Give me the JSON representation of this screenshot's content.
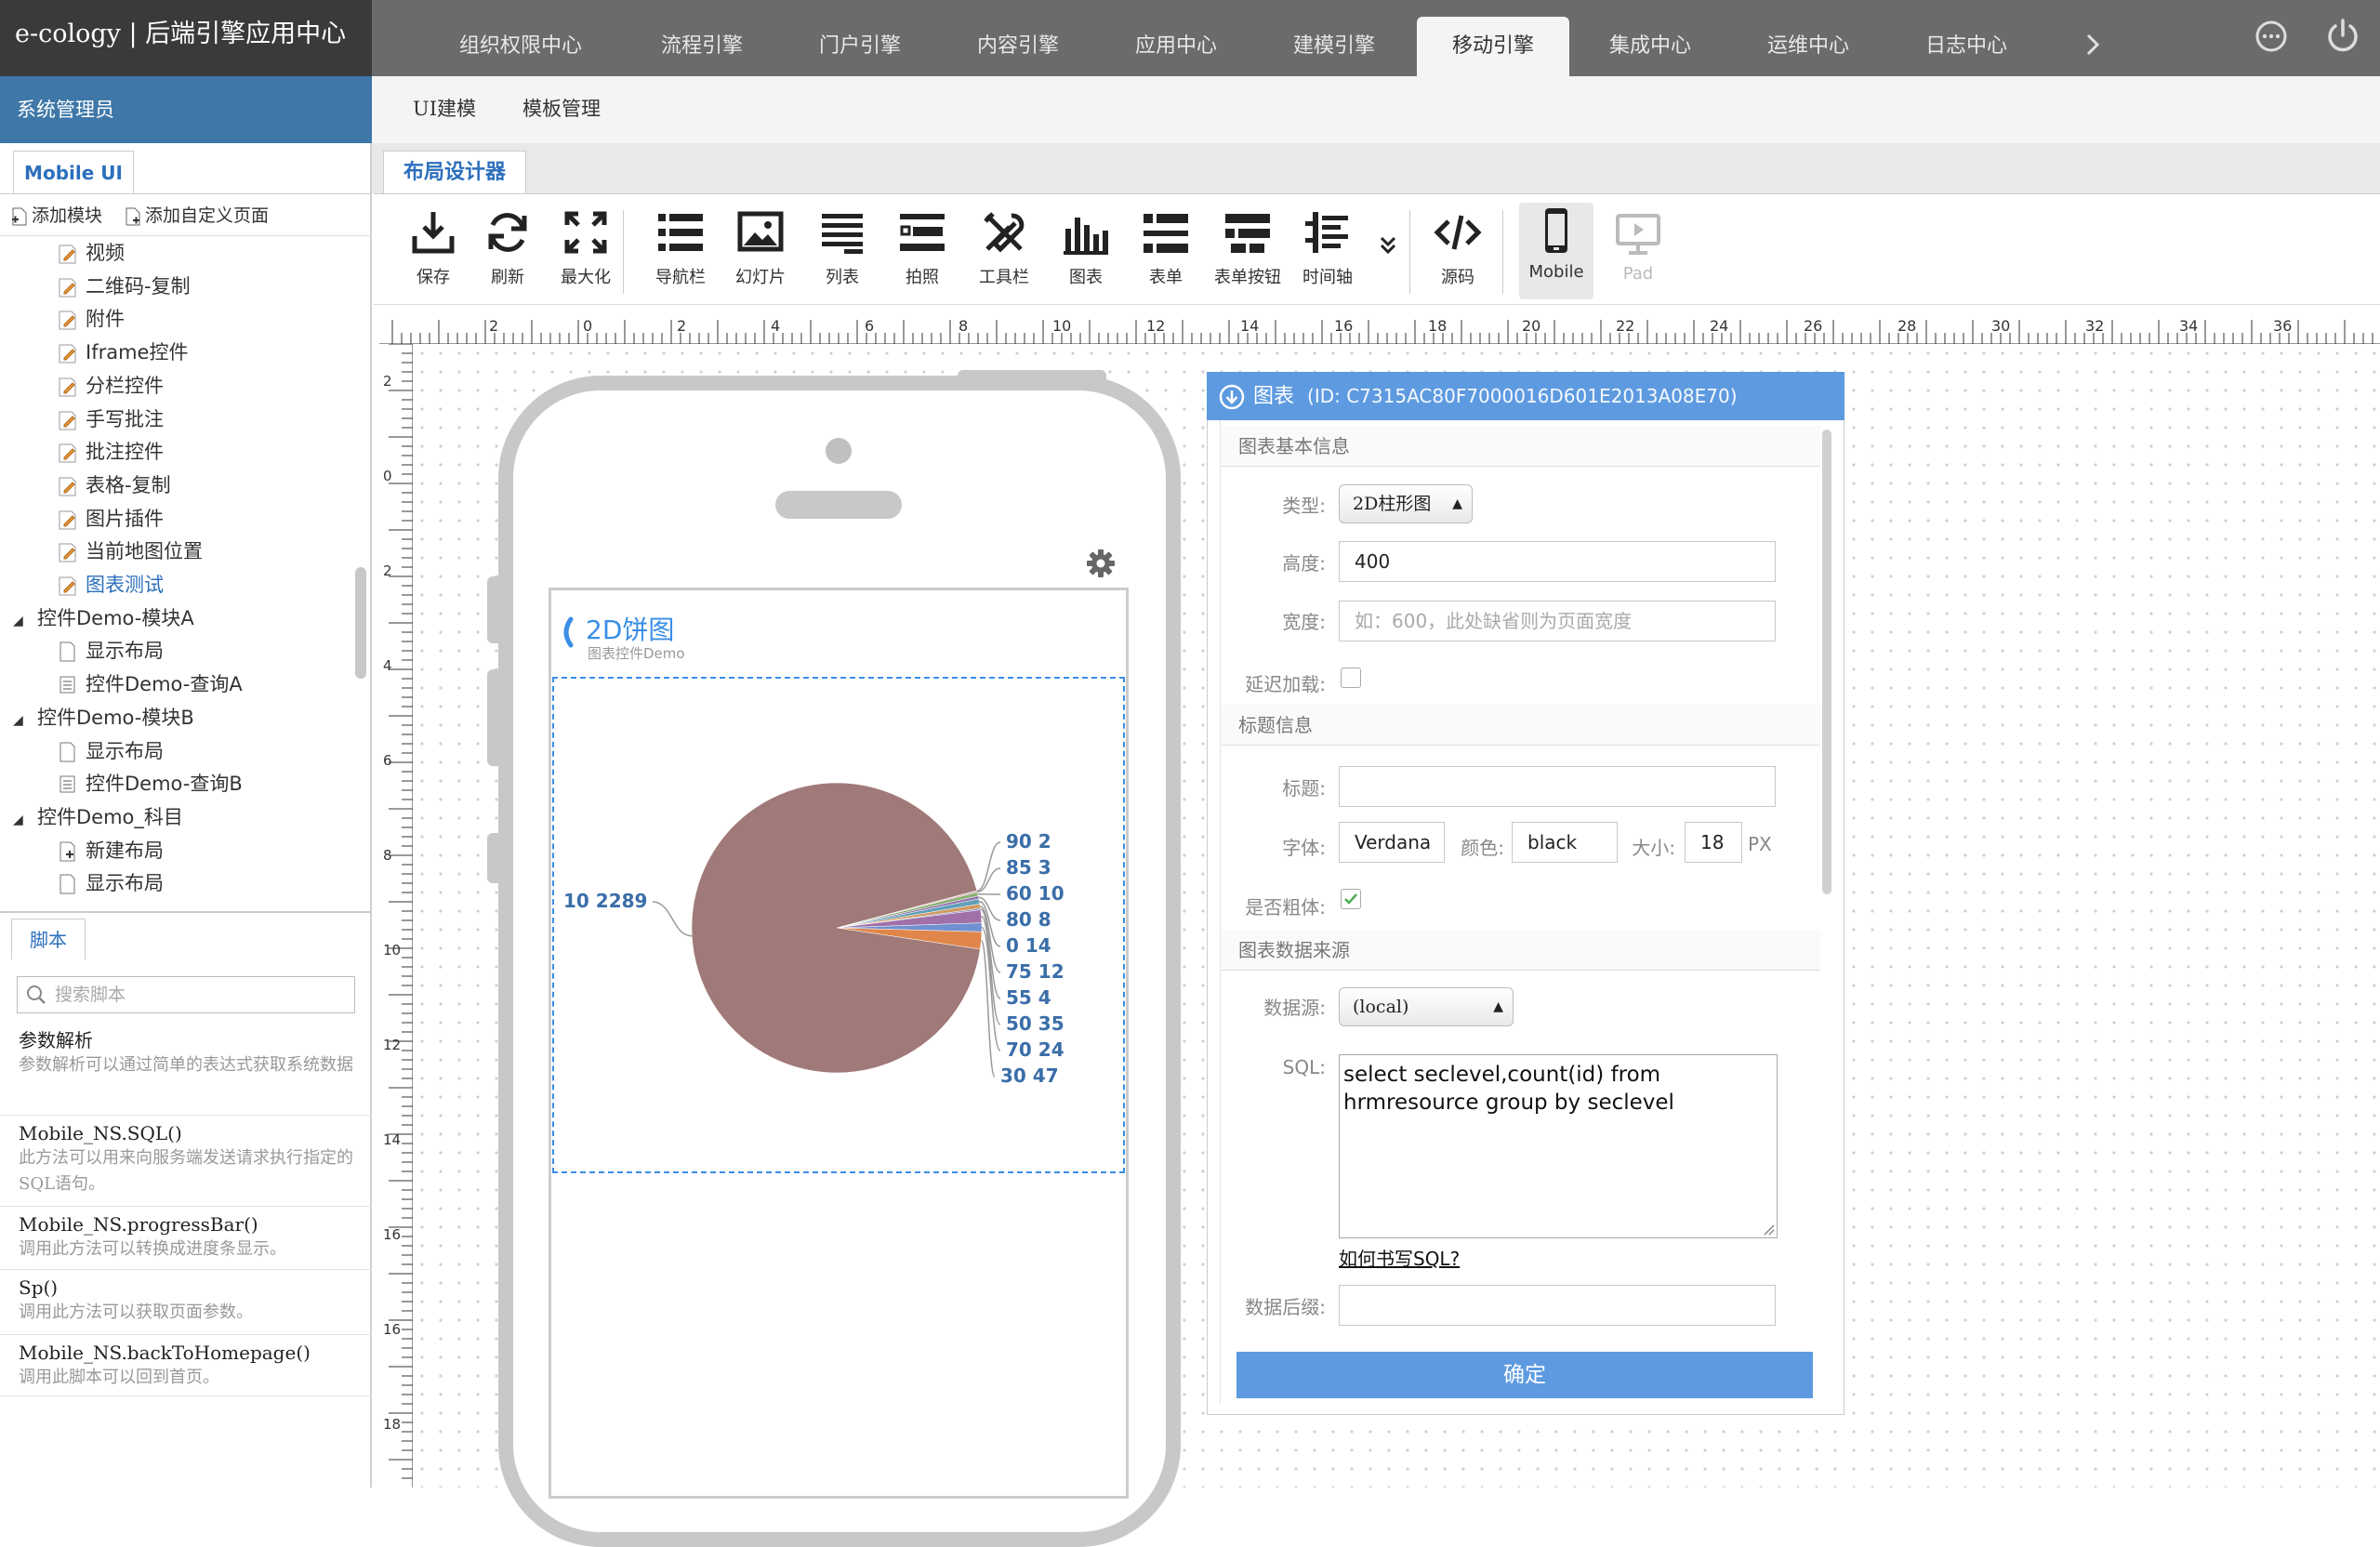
{
  "brand": "e-cology | 后端引擎应用中心",
  "top_nav": [
    "组织权限中心",
    "流程引擎",
    "门户引擎",
    "内容引擎",
    "应用中心",
    "建模引擎",
    "移动引擎",
    "集成中心",
    "运维中心",
    "日志中心"
  ],
  "top_nav_active": "移动引擎",
  "sidebar": {
    "admin_label": "系统管理员",
    "tab": "Mobile UI",
    "toolbar": {
      "add_module": "添加模块",
      "add_custom_page": "添加自定义页面"
    },
    "tree": [
      {
        "label": "视频",
        "indent": 2,
        "type": "leaf"
      },
      {
        "label": "二维码-复制",
        "indent": 2,
        "type": "leaf"
      },
      {
        "label": "附件",
        "indent": 2,
        "type": "leaf"
      },
      {
        "label": "Iframe控件",
        "indent": 2,
        "type": "leaf"
      },
      {
        "label": "分栏控件",
        "indent": 2,
        "type": "leaf"
      },
      {
        "label": "手写批注",
        "indent": 2,
        "type": "leaf"
      },
      {
        "label": "批注控件",
        "indent": 2,
        "type": "leaf"
      },
      {
        "label": "表格-复制",
        "indent": 2,
        "type": "leaf"
      },
      {
        "label": "图片插件",
        "indent": 2,
        "type": "leaf"
      },
      {
        "label": "当前地图位置",
        "indent": 2,
        "type": "leaf"
      },
      {
        "label": "图表测试",
        "indent": 2,
        "type": "leaf",
        "selected": true
      },
      {
        "label": "控件Demo-模块A",
        "indent": 1,
        "type": "folder"
      },
      {
        "label": "显示布局",
        "indent": 2,
        "type": "page"
      },
      {
        "label": "控件Demo-查询A",
        "indent": 2,
        "type": "query"
      },
      {
        "label": "控件Demo-模块B",
        "indent": 1,
        "type": "folder"
      },
      {
        "label": "显示布局",
        "indent": 2,
        "type": "page"
      },
      {
        "label": "控件Demo-查询B",
        "indent": 2,
        "type": "query"
      },
      {
        "label": "控件Demo_科目",
        "indent": 1,
        "type": "folder"
      },
      {
        "label": "新建布局",
        "indent": 2,
        "type": "newpage"
      },
      {
        "label": "显示布局",
        "indent": 2,
        "type": "page"
      }
    ],
    "script_tab": "脚本",
    "script_search_placeholder": "搜索脚本",
    "scripts": [
      {
        "title": "参数解析",
        "desc": "参数解析可以通过简单的表达式获取系统数据"
      },
      {
        "title": "Mobile_NS.SQL()",
        "desc": "此方法可以用来向服务端发送请求执行指定的SQL语句。"
      },
      {
        "title": "Mobile_NS.progressBar()",
        "desc": "调用此方法可以转换成进度条显示。"
      },
      {
        "title": "Sp()",
        "desc": "调用此方法可以获取页面参数。"
      },
      {
        "title": "Mobile_NS.backToHomepage()",
        "desc": "调用此脚本可以回到首页。"
      }
    ]
  },
  "sub_nav": [
    "UI建模",
    "模板管理"
  ],
  "designer_tab": "布局设计器",
  "toolbar": [
    {
      "label": "保存",
      "icon": "save-icon"
    },
    {
      "label": "刷新",
      "icon": "refresh-icon"
    },
    {
      "label": "最大化",
      "icon": "maximize-icon"
    },
    {
      "label": "导航栏",
      "icon": "navbar-icon"
    },
    {
      "label": "幻灯片",
      "icon": "slideshow-icon"
    },
    {
      "label": "列表",
      "icon": "list-icon"
    },
    {
      "label": "拍照",
      "icon": "photo-icon"
    },
    {
      "label": "工具栏",
      "icon": "tools-icon"
    },
    {
      "label": "图表",
      "icon": "chart-icon"
    },
    {
      "label": "表单",
      "icon": "form-icon"
    },
    {
      "label": "表单按钮",
      "icon": "form-button-icon"
    },
    {
      "label": "时间轴",
      "icon": "timeline-icon"
    },
    {
      "label": "源码",
      "icon": "source-code-icon"
    },
    {
      "label": "Mobile",
      "icon": "mobile-icon"
    },
    {
      "label": "Pad",
      "icon": "pad-icon"
    }
  ],
  "ruler": {
    "h_labels": [
      "2",
      "0",
      "2",
      "4",
      "6",
      "8",
      "10",
      "12",
      "14",
      "16",
      "18",
      "20",
      "22",
      "24",
      "26",
      "28",
      "30",
      "32",
      "34",
      "36"
    ],
    "v_labels": [
      "2",
      "0",
      "2",
      "4",
      "6",
      "8",
      "10",
      "12",
      "14",
      "16",
      "16",
      "18"
    ]
  },
  "phone_chart": {
    "title": "2D饼图",
    "subtitle": "图表控件Demo"
  },
  "chart_data": {
    "type": "pie",
    "categories": [
      "10",
      "90",
      "85",
      "60",
      "80",
      "0",
      "75",
      "55",
      "50",
      "70",
      "30"
    ],
    "values": [
      2289,
      2,
      3,
      10,
      8,
      14,
      12,
      4,
      35,
      24,
      47
    ],
    "labels": [
      "10 2289",
      "90 2",
      "85 3",
      "60 10",
      "80 8",
      "0 14",
      "75 12",
      "55 4",
      "50 35",
      "70 24",
      "30 47"
    ],
    "colors": [
      "#a07a78",
      "#7aa0c8",
      "#c07080",
      "#8ab070",
      "#9070b0",
      "#60a0b8",
      "#d09a60",
      "#8080c0",
      "#a070a8",
      "#7090d0",
      "#e0864a"
    ],
    "title": "2D饼图"
  },
  "dialog": {
    "title": "图表",
    "id_text": "(ID: C7315AC80F7000016D601E2013A08E70)",
    "sections": {
      "basic": "图表基本信息",
      "title_info": "标题信息",
      "data_source": "图表数据来源"
    },
    "labels": {
      "type": "类型:",
      "height": "高度:",
      "width": "宽度:",
      "lazy": "延迟加载:",
      "title": "标题:",
      "font": "字体:",
      "color": "颜色:",
      "size": "大小:",
      "px": "PX",
      "bold": "是否粗体:",
      "datasource": "数据源:",
      "sql": "SQL:",
      "suffix": "数据后缀:"
    },
    "values": {
      "type": "2D柱形图",
      "height": "400",
      "width_placeholder": "如：600，此处缺省则为页面宽度",
      "title": "",
      "font": "Verdana",
      "color": "black",
      "size": "18",
      "datasource": "(local)",
      "sql_line1": "select seclevel,count(id) from",
      "sql_line2": "hrmresource group by seclevel",
      "suffix": ""
    },
    "lazy_checked": false,
    "bold_checked": true,
    "sql_help_link": "如何书写SQL?",
    "confirm": "确定"
  }
}
